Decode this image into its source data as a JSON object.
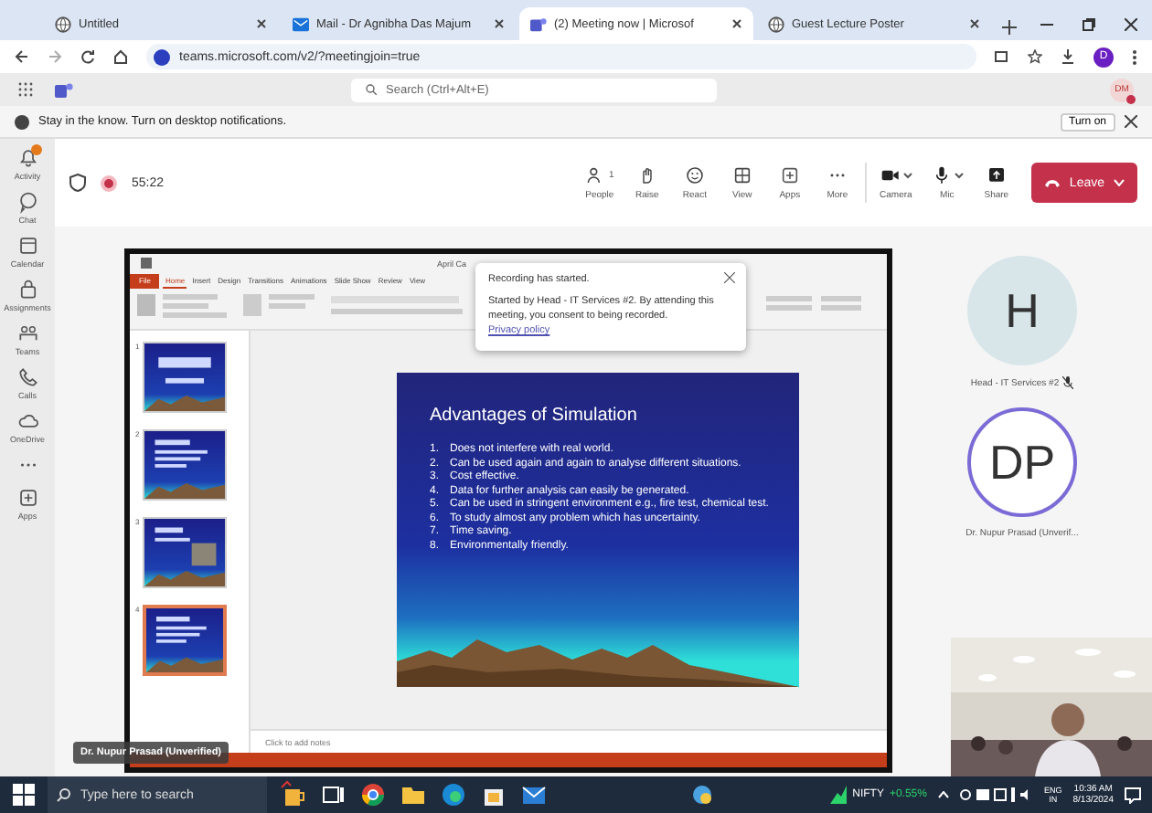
{
  "browser": {
    "tabs": [
      {
        "title": "Untitled",
        "selected": false,
        "kind": "globe"
      },
      {
        "title": "Mail - Dr Agnibha Das Majum",
        "selected": false,
        "kind": "mail"
      },
      {
        "title": "(2) Meeting now | Microsof",
        "selected": true,
        "kind": "teams"
      },
      {
        "title": "Guest Lecture Poster",
        "selected": false,
        "kind": "globe"
      }
    ],
    "url": "teams.microsoft.com/v2/?meetingjoin=true",
    "profile": "D"
  },
  "teams": {
    "search": {
      "placeholder": "Search (Ctrl+Alt+E)"
    },
    "avatar": "DM"
  },
  "notice": {
    "text": "Stay in the know. Turn on desktop notifications.",
    "button": "Turn on"
  },
  "rail": [
    {
      "label": "Activity",
      "kind": "bell",
      "badge": true
    },
    {
      "label": "Chat",
      "kind": "chat",
      "badge": false
    },
    {
      "label": "Calendar",
      "kind": "calendar",
      "badge": false
    },
    {
      "label": "Assignments",
      "kind": "bag",
      "badge": false
    },
    {
      "label": "Teams",
      "kind": "teams",
      "badge": false
    },
    {
      "label": "Calls",
      "kind": "phone",
      "badge": false
    },
    {
      "label": "OneDrive",
      "kind": "cloud",
      "badge": false
    },
    {
      "kind": "more",
      "badge": false
    },
    {
      "label": "Apps",
      "kind": "plus",
      "badge": false
    }
  ],
  "meeting": {
    "timer": "55:22",
    "recording": true,
    "controls": [
      {
        "label": "People",
        "kind": "people",
        "count": "1",
        "dropdown": false
      },
      {
        "label": "Raise",
        "kind": "hand",
        "dropdown": false
      },
      {
        "label": "React",
        "kind": "smile",
        "dropdown": false
      },
      {
        "label": "View",
        "kind": "grid",
        "dropdown": false
      },
      {
        "label": "Apps",
        "kind": "plus",
        "dropdown": false
      },
      {
        "label": "More",
        "kind": "dots",
        "dropdown": false
      },
      {
        "label": "Camera",
        "kind": "camera",
        "dropdown": true
      },
      {
        "label": "Mic",
        "kind": "mic",
        "dropdown": true
      },
      {
        "label": "Share",
        "kind": "share",
        "dropdown": false
      }
    ],
    "leave": "Leave"
  },
  "share": {
    "app": {
      "title": "April Ca",
      "tabs": [
        {
          "label": "File",
          "kind": "file",
          "selected": false
        },
        {
          "label": "Home",
          "kind": "tab",
          "selected": true
        },
        {
          "label": "Insert",
          "kind": "tab",
          "selected": false
        },
        {
          "label": "Design",
          "kind": "tab",
          "selected": false
        },
        {
          "label": "Transitions",
          "kind": "tab",
          "selected": false
        },
        {
          "label": "Animations",
          "kind": "tab",
          "selected": false
        },
        {
          "label": "Slide Show",
          "kind": "tab",
          "selected": false
        },
        {
          "label": "Review",
          "kind": "tab",
          "selected": false
        },
        {
          "label": "View",
          "kind": "tab",
          "selected": false
        }
      ]
    },
    "thumbnails": [
      {
        "number": "1",
        "selected": false,
        "kind": "title"
      },
      {
        "number": "2",
        "selected": false,
        "kind": "text"
      },
      {
        "number": "3",
        "selected": false
      },
      {
        "number": "4",
        "selected": true,
        "kind": "text"
      }
    ],
    "slide": {
      "title": "Advantages of Simulation",
      "points": [
        {
          "number": "1.",
          "text": "Does not interfere with real world."
        },
        {
          "number": "2.",
          "text": "Can be used again and again to analyse different situations."
        },
        {
          "number": "3.",
          "text": "Cost effective."
        },
        {
          "number": "4.",
          "text": "Data for further analysis can easily be generated."
        },
        {
          "number": "5.",
          "text": "Can be used in stringent environment e.g., fire test, chemical test."
        },
        {
          "number": "6.",
          "text": "To study almost any problem which has uncertainty."
        },
        {
          "number": "7.",
          "text": "Time saving."
        },
        {
          "number": "8.",
          "text": "Environmentally friendly."
        }
      ]
    },
    "notes_placeholder": "Click to add notes",
    "popup": {
      "title": "Recording has started.",
      "body": "Started by Head - IT Services #2. By attending this meeting, you consent to being recorded.",
      "link": "Privacy policy"
    },
    "presenter": "Dr. Nupur Prasad (Unverified)"
  },
  "participants": [
    {
      "initials": "H",
      "name": "Head - IT Services #2",
      "muted": true,
      "speaking": false
    },
    {
      "initials": "DP",
      "name": "Dr. Nupur Prasad (Unverif...",
      "muted": false,
      "speaking": true
    }
  ],
  "taskbar": {
    "search": {
      "placeholder": "Type here to search"
    },
    "ticker": {
      "name": "NIFTY",
      "change": "+0.55%"
    },
    "language": "ENG",
    "region": "IN",
    "time": "10:36 AM",
    "date": "8/13/2024"
  }
}
